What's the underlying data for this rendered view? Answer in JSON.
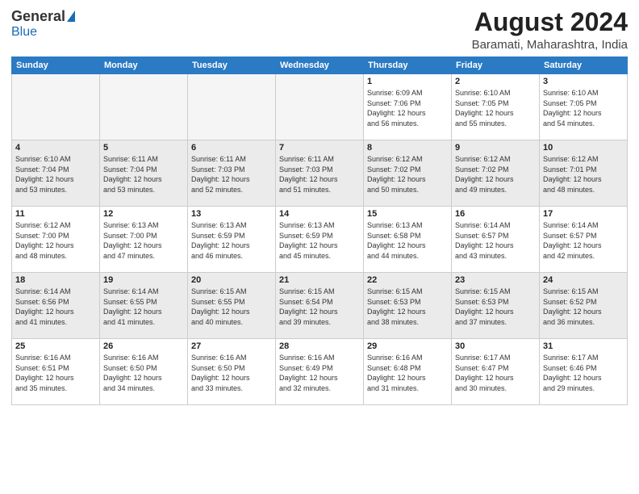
{
  "header": {
    "logo": {
      "general": "General",
      "blue": "Blue"
    },
    "title": "August 2024",
    "location": "Baramati, Maharashtra, India"
  },
  "weekdays": [
    "Sunday",
    "Monday",
    "Tuesday",
    "Wednesday",
    "Thursday",
    "Friday",
    "Saturday"
  ],
  "weeks": [
    [
      {
        "day": "",
        "info": "",
        "empty": true
      },
      {
        "day": "",
        "info": "",
        "empty": true
      },
      {
        "day": "",
        "info": "",
        "empty": true
      },
      {
        "day": "",
        "info": "",
        "empty": true
      },
      {
        "day": "1",
        "info": "Sunrise: 6:09 AM\nSunset: 7:06 PM\nDaylight: 12 hours\nand 56 minutes."
      },
      {
        "day": "2",
        "info": "Sunrise: 6:10 AM\nSunset: 7:05 PM\nDaylight: 12 hours\nand 55 minutes."
      },
      {
        "day": "3",
        "info": "Sunrise: 6:10 AM\nSunset: 7:05 PM\nDaylight: 12 hours\nand 54 minutes."
      }
    ],
    [
      {
        "day": "4",
        "info": "Sunrise: 6:10 AM\nSunset: 7:04 PM\nDaylight: 12 hours\nand 53 minutes."
      },
      {
        "day": "5",
        "info": "Sunrise: 6:11 AM\nSunset: 7:04 PM\nDaylight: 12 hours\nand 53 minutes."
      },
      {
        "day": "6",
        "info": "Sunrise: 6:11 AM\nSunset: 7:03 PM\nDaylight: 12 hours\nand 52 minutes."
      },
      {
        "day": "7",
        "info": "Sunrise: 6:11 AM\nSunset: 7:03 PM\nDaylight: 12 hours\nand 51 minutes."
      },
      {
        "day": "8",
        "info": "Sunrise: 6:12 AM\nSunset: 7:02 PM\nDaylight: 12 hours\nand 50 minutes."
      },
      {
        "day": "9",
        "info": "Sunrise: 6:12 AM\nSunset: 7:02 PM\nDaylight: 12 hours\nand 49 minutes."
      },
      {
        "day": "10",
        "info": "Sunrise: 6:12 AM\nSunset: 7:01 PM\nDaylight: 12 hours\nand 48 minutes."
      }
    ],
    [
      {
        "day": "11",
        "info": "Sunrise: 6:12 AM\nSunset: 7:00 PM\nDaylight: 12 hours\nand 48 minutes."
      },
      {
        "day": "12",
        "info": "Sunrise: 6:13 AM\nSunset: 7:00 PM\nDaylight: 12 hours\nand 47 minutes."
      },
      {
        "day": "13",
        "info": "Sunrise: 6:13 AM\nSunset: 6:59 PM\nDaylight: 12 hours\nand 46 minutes."
      },
      {
        "day": "14",
        "info": "Sunrise: 6:13 AM\nSunset: 6:59 PM\nDaylight: 12 hours\nand 45 minutes."
      },
      {
        "day": "15",
        "info": "Sunrise: 6:13 AM\nSunset: 6:58 PM\nDaylight: 12 hours\nand 44 minutes."
      },
      {
        "day": "16",
        "info": "Sunrise: 6:14 AM\nSunset: 6:57 PM\nDaylight: 12 hours\nand 43 minutes."
      },
      {
        "day": "17",
        "info": "Sunrise: 6:14 AM\nSunset: 6:57 PM\nDaylight: 12 hours\nand 42 minutes."
      }
    ],
    [
      {
        "day": "18",
        "info": "Sunrise: 6:14 AM\nSunset: 6:56 PM\nDaylight: 12 hours\nand 41 minutes."
      },
      {
        "day": "19",
        "info": "Sunrise: 6:14 AM\nSunset: 6:55 PM\nDaylight: 12 hours\nand 41 minutes."
      },
      {
        "day": "20",
        "info": "Sunrise: 6:15 AM\nSunset: 6:55 PM\nDaylight: 12 hours\nand 40 minutes."
      },
      {
        "day": "21",
        "info": "Sunrise: 6:15 AM\nSunset: 6:54 PM\nDaylight: 12 hours\nand 39 minutes."
      },
      {
        "day": "22",
        "info": "Sunrise: 6:15 AM\nSunset: 6:53 PM\nDaylight: 12 hours\nand 38 minutes."
      },
      {
        "day": "23",
        "info": "Sunrise: 6:15 AM\nSunset: 6:53 PM\nDaylight: 12 hours\nand 37 minutes."
      },
      {
        "day": "24",
        "info": "Sunrise: 6:15 AM\nSunset: 6:52 PM\nDaylight: 12 hours\nand 36 minutes."
      }
    ],
    [
      {
        "day": "25",
        "info": "Sunrise: 6:16 AM\nSunset: 6:51 PM\nDaylight: 12 hours\nand 35 minutes."
      },
      {
        "day": "26",
        "info": "Sunrise: 6:16 AM\nSunset: 6:50 PM\nDaylight: 12 hours\nand 34 minutes."
      },
      {
        "day": "27",
        "info": "Sunrise: 6:16 AM\nSunset: 6:50 PM\nDaylight: 12 hours\nand 33 minutes."
      },
      {
        "day": "28",
        "info": "Sunrise: 6:16 AM\nSunset: 6:49 PM\nDaylight: 12 hours\nand 32 minutes."
      },
      {
        "day": "29",
        "info": "Sunrise: 6:16 AM\nSunset: 6:48 PM\nDaylight: 12 hours\nand 31 minutes."
      },
      {
        "day": "30",
        "info": "Sunrise: 6:17 AM\nSunset: 6:47 PM\nDaylight: 12 hours\nand 30 minutes."
      },
      {
        "day": "31",
        "info": "Sunrise: 6:17 AM\nSunset: 6:46 PM\nDaylight: 12 hours\nand 29 minutes."
      }
    ]
  ]
}
